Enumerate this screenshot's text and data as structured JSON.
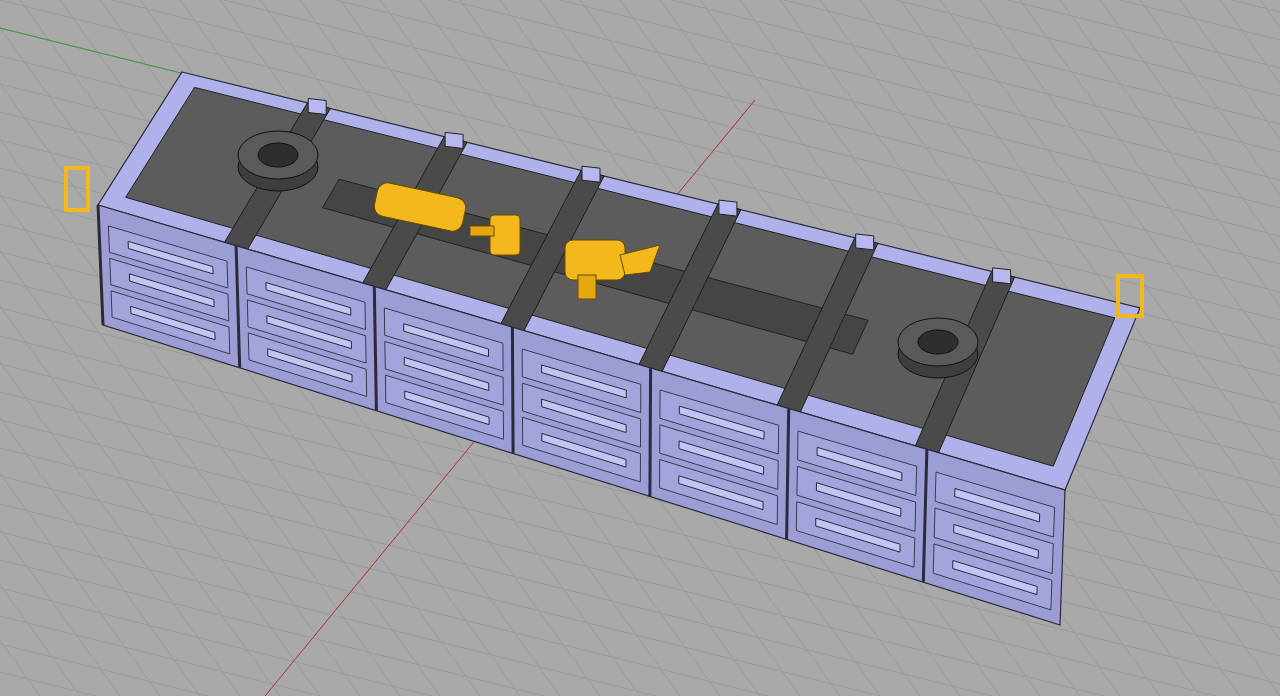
{
  "viewport": {
    "kind": "perspective"
  }
}
